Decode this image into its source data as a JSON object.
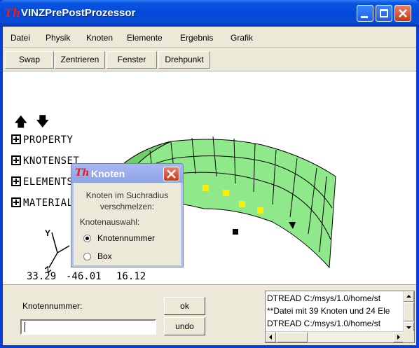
{
  "window": {
    "logo": "Th",
    "title": "VINZPrePostProzessor"
  },
  "menu": [
    "Datei",
    "Physik",
    "Knoten",
    "Elemente",
    "Ergebnis",
    "Grafik"
  ],
  "toolbar": [
    "Swap",
    "Zentrieren",
    "Fenster",
    "Drehpunkt"
  ],
  "viewport": {
    "arrows": {
      "up": "🡅",
      "down": "🡇"
    },
    "tree": [
      "PROPERTY",
      "KNOTENSET",
      "ELEMENTSET",
      "MATERIAL"
    ],
    "axes": {
      "y": "Y",
      "z": "Z"
    },
    "coordinates": [
      "33.29",
      "-46.01",
      "16.12"
    ],
    "mesh_color": "#8fe98a",
    "highlight_node_color": "#ffee00"
  },
  "dialog": {
    "logo": "Th",
    "title": "Knoten",
    "description_line1": "Knoten im Suchradius",
    "description_line2": "verschmelzen:",
    "selection_label": "Knotenauswahl:",
    "options": [
      "Knotennummer",
      "Box"
    ],
    "selected": "Knotennummer"
  },
  "input": {
    "label": "Knotennummer:",
    "value": ""
  },
  "buttons": {
    "ok": "ok",
    "undo": "undo"
  },
  "log": [
    "DTREAD C:/msys/1.0/home/st",
    "**Datei mit 39 Knoten und 24 Ele",
    "DTREAD C:/msys/1.0/home/st"
  ]
}
